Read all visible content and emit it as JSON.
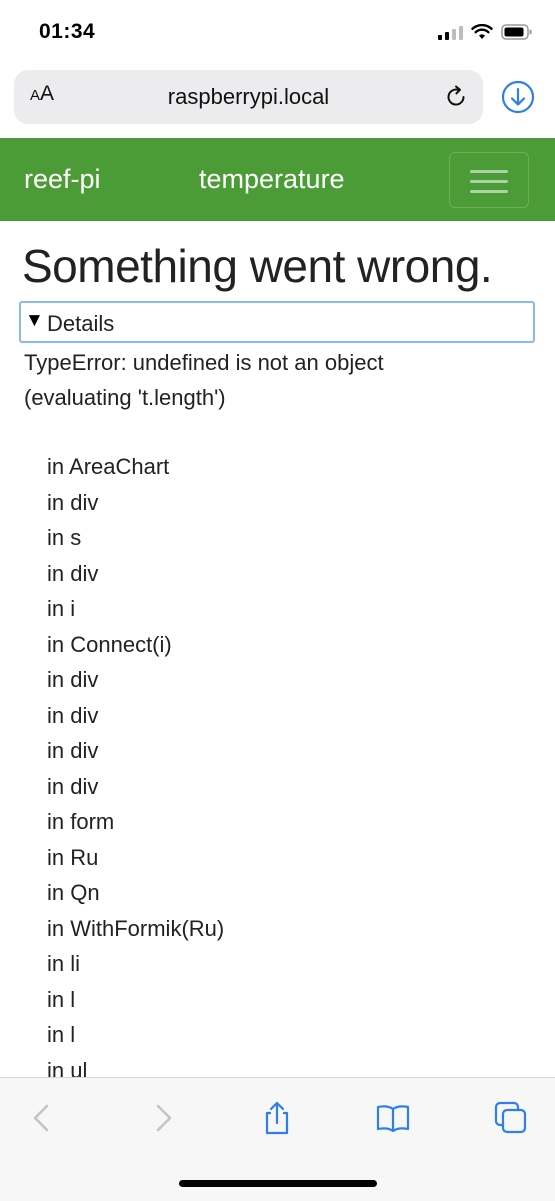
{
  "status_bar": {
    "time": "01:34"
  },
  "browser": {
    "aa_label": "AA",
    "url": "raspberrypi.local"
  },
  "navbar": {
    "brand": "reef-pi",
    "title": "temperature"
  },
  "error": {
    "heading": "Something went wrong.",
    "details_label": "Details",
    "message_line1": "TypeError: undefined is not an object",
    "message_line2": "(evaluating 't.length')",
    "stack": [
      "in AreaChart",
      "in div",
      "in s",
      "in div",
      "in i",
      "in Connect(i)",
      "in div",
      "in div",
      "in div",
      "in div",
      "in form",
      "in Ru",
      "in Qn",
      "in WithFormik(Ru)",
      "in li",
      "in l",
      "in l",
      "in ul"
    ]
  },
  "colors": {
    "navbar_bg": "#4b9c36",
    "accent_blue": "#2f7fe8",
    "details_border": "#8db8ef"
  },
  "icons": [
    "signal-icon",
    "wifi-icon",
    "battery-icon",
    "reload-icon",
    "download-icon",
    "back-icon",
    "forward-icon",
    "share-icon",
    "bookmarks-icon",
    "tabs-icon",
    "menu-toggle-icon"
  ]
}
